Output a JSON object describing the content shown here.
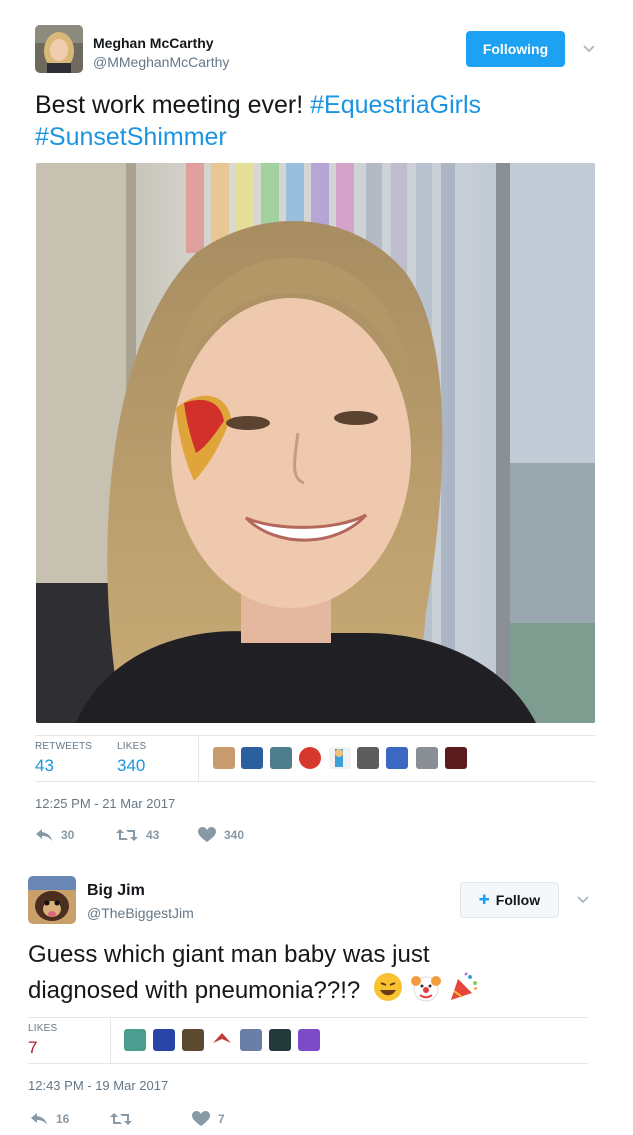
{
  "tweet1": {
    "name": "Meghan McCarthy",
    "handle": "@MMeghanMcCarthy",
    "follow_label": "Following",
    "text_plain": "Best work meeting ever!",
    "hashtag1": "#EquestriaGirls",
    "hashtag2": "#SunsetShimmer",
    "retweets_label": "RETWEETS",
    "retweets": "43",
    "likes_label": "LIKES",
    "likes": "340",
    "timestamp": "12:25 PM - 21 Mar 2017",
    "reply_count": "30",
    "retweet_count": "43",
    "like_count": "340"
  },
  "tweet2": {
    "name": "Big Jim",
    "handle": "@TheBiggestJim",
    "follow_label": "Follow",
    "text_line1": "Guess which giant man baby was just",
    "text_line2": "diagnosed with pneumonia??!?",
    "likes_label": "LIKES",
    "likes": "7",
    "timestamp": "12:43 PM - 19 Mar 2017",
    "reply_count": "16",
    "like_count": "7"
  },
  "colors": {
    "accent": "#1da1f2",
    "link": "#1b95e0",
    "like_red": "#ab1b30",
    "muted": "#657786"
  }
}
